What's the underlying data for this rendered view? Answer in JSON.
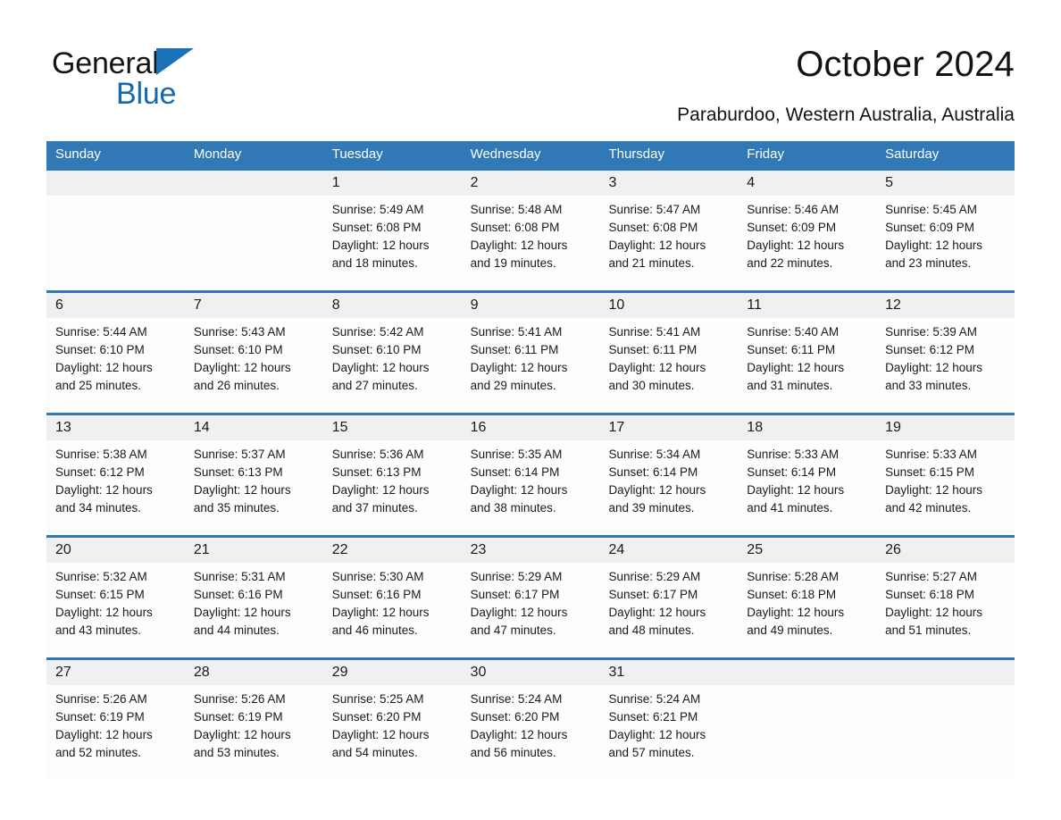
{
  "brand": {
    "name_part1": "General",
    "name_part2": "Blue",
    "triangle_color": "#1b72b8",
    "blue_color": "#1269b0"
  },
  "header": {
    "title": "October 2024",
    "subtitle": "Paraburdoo, Western Australia, Australia"
  },
  "theme": {
    "header_bar": "#3179b6",
    "date_band": "#f0f0f0",
    "cell_bg": "#fdfdfd",
    "text": "#1a1a1a"
  },
  "weekdays": [
    "Sunday",
    "Monday",
    "Tuesday",
    "Wednesday",
    "Thursday",
    "Friday",
    "Saturday"
  ],
  "weeks": [
    {
      "days": [
        {
          "num": "",
          "l1": "",
          "l2": "",
          "l3": "",
          "l4": ""
        },
        {
          "num": "",
          "l1": "",
          "l2": "",
          "l3": "",
          "l4": ""
        },
        {
          "num": "1",
          "l1": "Sunrise: 5:49 AM",
          "l2": "Sunset: 6:08 PM",
          "l3": "Daylight: 12 hours",
          "l4": "and 18 minutes."
        },
        {
          "num": "2",
          "l1": "Sunrise: 5:48 AM",
          "l2": "Sunset: 6:08 PM",
          "l3": "Daylight: 12 hours",
          "l4": "and 19 minutes."
        },
        {
          "num": "3",
          "l1": "Sunrise: 5:47 AM",
          "l2": "Sunset: 6:08 PM",
          "l3": "Daylight: 12 hours",
          "l4": "and 21 minutes."
        },
        {
          "num": "4",
          "l1": "Sunrise: 5:46 AM",
          "l2": "Sunset: 6:09 PM",
          "l3": "Daylight: 12 hours",
          "l4": "and 22 minutes."
        },
        {
          "num": "5",
          "l1": "Sunrise: 5:45 AM",
          "l2": "Sunset: 6:09 PM",
          "l3": "Daylight: 12 hours",
          "l4": "and 23 minutes."
        }
      ]
    },
    {
      "days": [
        {
          "num": "6",
          "l1": "Sunrise: 5:44 AM",
          "l2": "Sunset: 6:10 PM",
          "l3": "Daylight: 12 hours",
          "l4": "and 25 minutes."
        },
        {
          "num": "7",
          "l1": "Sunrise: 5:43 AM",
          "l2": "Sunset: 6:10 PM",
          "l3": "Daylight: 12 hours",
          "l4": "and 26 minutes."
        },
        {
          "num": "8",
          "l1": "Sunrise: 5:42 AM",
          "l2": "Sunset: 6:10 PM",
          "l3": "Daylight: 12 hours",
          "l4": "and 27 minutes."
        },
        {
          "num": "9",
          "l1": "Sunrise: 5:41 AM",
          "l2": "Sunset: 6:11 PM",
          "l3": "Daylight: 12 hours",
          "l4": "and 29 minutes."
        },
        {
          "num": "10",
          "l1": "Sunrise: 5:41 AM",
          "l2": "Sunset: 6:11 PM",
          "l3": "Daylight: 12 hours",
          "l4": "and 30 minutes."
        },
        {
          "num": "11",
          "l1": "Sunrise: 5:40 AM",
          "l2": "Sunset: 6:11 PM",
          "l3": "Daylight: 12 hours",
          "l4": "and 31 minutes."
        },
        {
          "num": "12",
          "l1": "Sunrise: 5:39 AM",
          "l2": "Sunset: 6:12 PM",
          "l3": "Daylight: 12 hours",
          "l4": "and 33 minutes."
        }
      ]
    },
    {
      "days": [
        {
          "num": "13",
          "l1": "Sunrise: 5:38 AM",
          "l2": "Sunset: 6:12 PM",
          "l3": "Daylight: 12 hours",
          "l4": "and 34 minutes."
        },
        {
          "num": "14",
          "l1": "Sunrise: 5:37 AM",
          "l2": "Sunset: 6:13 PM",
          "l3": "Daylight: 12 hours",
          "l4": "and 35 minutes."
        },
        {
          "num": "15",
          "l1": "Sunrise: 5:36 AM",
          "l2": "Sunset: 6:13 PM",
          "l3": "Daylight: 12 hours",
          "l4": "and 37 minutes."
        },
        {
          "num": "16",
          "l1": "Sunrise: 5:35 AM",
          "l2": "Sunset: 6:14 PM",
          "l3": "Daylight: 12 hours",
          "l4": "and 38 minutes."
        },
        {
          "num": "17",
          "l1": "Sunrise: 5:34 AM",
          "l2": "Sunset: 6:14 PM",
          "l3": "Daylight: 12 hours",
          "l4": "and 39 minutes."
        },
        {
          "num": "18",
          "l1": "Sunrise: 5:33 AM",
          "l2": "Sunset: 6:14 PM",
          "l3": "Daylight: 12 hours",
          "l4": "and 41 minutes."
        },
        {
          "num": "19",
          "l1": "Sunrise: 5:33 AM",
          "l2": "Sunset: 6:15 PM",
          "l3": "Daylight: 12 hours",
          "l4": "and 42 minutes."
        }
      ]
    },
    {
      "days": [
        {
          "num": "20",
          "l1": "Sunrise: 5:32 AM",
          "l2": "Sunset: 6:15 PM",
          "l3": "Daylight: 12 hours",
          "l4": "and 43 minutes."
        },
        {
          "num": "21",
          "l1": "Sunrise: 5:31 AM",
          "l2": "Sunset: 6:16 PM",
          "l3": "Daylight: 12 hours",
          "l4": "and 44 minutes."
        },
        {
          "num": "22",
          "l1": "Sunrise: 5:30 AM",
          "l2": "Sunset: 6:16 PM",
          "l3": "Daylight: 12 hours",
          "l4": "and 46 minutes."
        },
        {
          "num": "23",
          "l1": "Sunrise: 5:29 AM",
          "l2": "Sunset: 6:17 PM",
          "l3": "Daylight: 12 hours",
          "l4": "and 47 minutes."
        },
        {
          "num": "24",
          "l1": "Sunrise: 5:29 AM",
          "l2": "Sunset: 6:17 PM",
          "l3": "Daylight: 12 hours",
          "l4": "and 48 minutes."
        },
        {
          "num": "25",
          "l1": "Sunrise: 5:28 AM",
          "l2": "Sunset: 6:18 PM",
          "l3": "Daylight: 12 hours",
          "l4": "and 49 minutes."
        },
        {
          "num": "26",
          "l1": "Sunrise: 5:27 AM",
          "l2": "Sunset: 6:18 PM",
          "l3": "Daylight: 12 hours",
          "l4": "and 51 minutes."
        }
      ]
    },
    {
      "days": [
        {
          "num": "27",
          "l1": "Sunrise: 5:26 AM",
          "l2": "Sunset: 6:19 PM",
          "l3": "Daylight: 12 hours",
          "l4": "and 52 minutes."
        },
        {
          "num": "28",
          "l1": "Sunrise: 5:26 AM",
          "l2": "Sunset: 6:19 PM",
          "l3": "Daylight: 12 hours",
          "l4": "and 53 minutes."
        },
        {
          "num": "29",
          "l1": "Sunrise: 5:25 AM",
          "l2": "Sunset: 6:20 PM",
          "l3": "Daylight: 12 hours",
          "l4": "and 54 minutes."
        },
        {
          "num": "30",
          "l1": "Sunrise: 5:24 AM",
          "l2": "Sunset: 6:20 PM",
          "l3": "Daylight: 12 hours",
          "l4": "and 56 minutes."
        },
        {
          "num": "31",
          "l1": "Sunrise: 5:24 AM",
          "l2": "Sunset: 6:21 PM",
          "l3": "Daylight: 12 hours",
          "l4": "and 57 minutes."
        },
        {
          "num": "",
          "l1": "",
          "l2": "",
          "l3": "",
          "l4": ""
        },
        {
          "num": "",
          "l1": "",
          "l2": "",
          "l3": "",
          "l4": ""
        }
      ]
    }
  ]
}
